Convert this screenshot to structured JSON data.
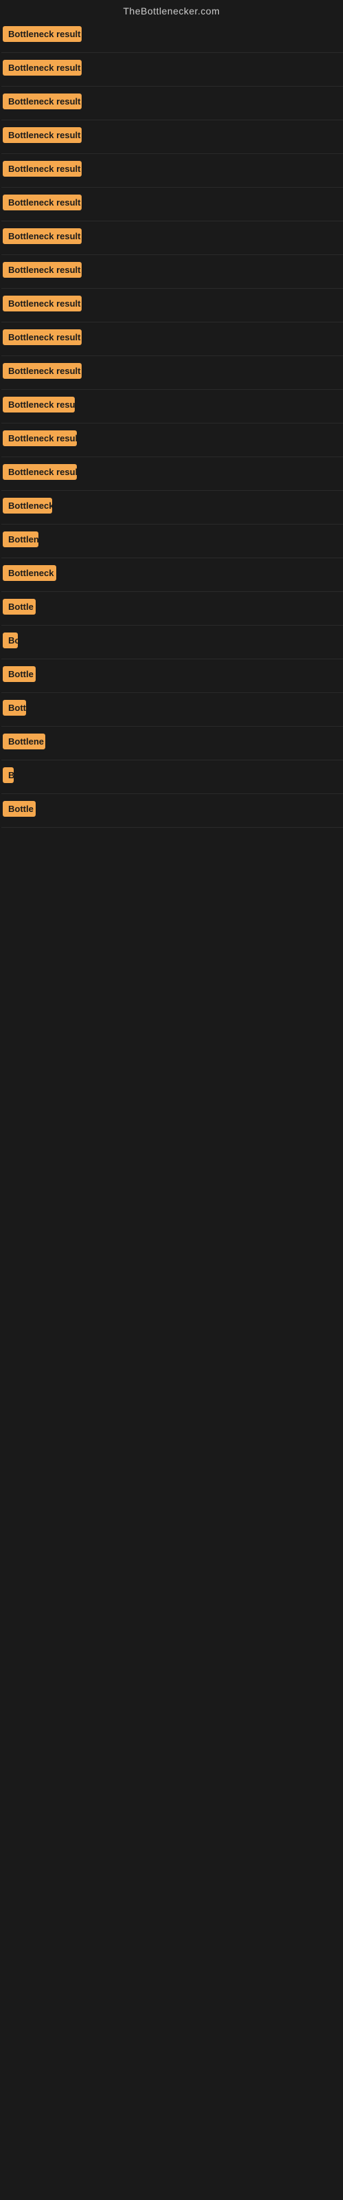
{
  "site": {
    "title": "TheBottlenecker.com"
  },
  "results": [
    {
      "id": 1,
      "label": "Bottleneck result",
      "visible_text": "Bottleneck result"
    },
    {
      "id": 2,
      "label": "Bottleneck result",
      "visible_text": "Bottleneck result"
    },
    {
      "id": 3,
      "label": "Bottleneck result",
      "visible_text": "Bottleneck result"
    },
    {
      "id": 4,
      "label": "Bottleneck result",
      "visible_text": "Bottleneck result"
    },
    {
      "id": 5,
      "label": "Bottleneck result",
      "visible_text": "Bottleneck result"
    },
    {
      "id": 6,
      "label": "Bottleneck result",
      "visible_text": "Bottleneck result"
    },
    {
      "id": 7,
      "label": "Bottleneck result",
      "visible_text": "Bottleneck result"
    },
    {
      "id": 8,
      "label": "Bottleneck result",
      "visible_text": "Bottleneck result"
    },
    {
      "id": 9,
      "label": "Bottleneck result",
      "visible_text": "Bottleneck result"
    },
    {
      "id": 10,
      "label": "Bottleneck result",
      "visible_text": "Bottleneck result"
    },
    {
      "id": 11,
      "label": "Bottleneck result",
      "visible_text": "Bottleneck result"
    },
    {
      "id": 12,
      "label": "Bottleneck resu",
      "visible_text": "Bottleneck resu"
    },
    {
      "id": 13,
      "label": "Bottleneck resul",
      "visible_text": "Bottleneck resul"
    },
    {
      "id": 14,
      "label": "Bottleneck resul",
      "visible_text": "Bottleneck resul"
    },
    {
      "id": 15,
      "label": "Bottleneck r",
      "visible_text": "Bottleneck r"
    },
    {
      "id": 16,
      "label": "Bottlen",
      "visible_text": "Bottlen"
    },
    {
      "id": 17,
      "label": "Bottleneck",
      "visible_text": "Bottleneck"
    },
    {
      "id": 18,
      "label": "Bottle",
      "visible_text": "Bottle"
    },
    {
      "id": 19,
      "label": "Bo",
      "visible_text": "Bo"
    },
    {
      "id": 20,
      "label": "Bottle",
      "visible_text": "Bottle"
    },
    {
      "id": 21,
      "label": "Bott",
      "visible_text": "Bott"
    },
    {
      "id": 22,
      "label": "Bottlene",
      "visible_text": "Bottlene"
    },
    {
      "id": 23,
      "label": "B",
      "visible_text": "B"
    },
    {
      "id": 24,
      "label": "Bottle",
      "visible_text": "Bottle"
    }
  ],
  "colors": {
    "badge_bg": "#f5a84e",
    "badge_text": "#1a1a1a",
    "page_bg": "#1a1a1a",
    "site_title": "#cccccc"
  }
}
